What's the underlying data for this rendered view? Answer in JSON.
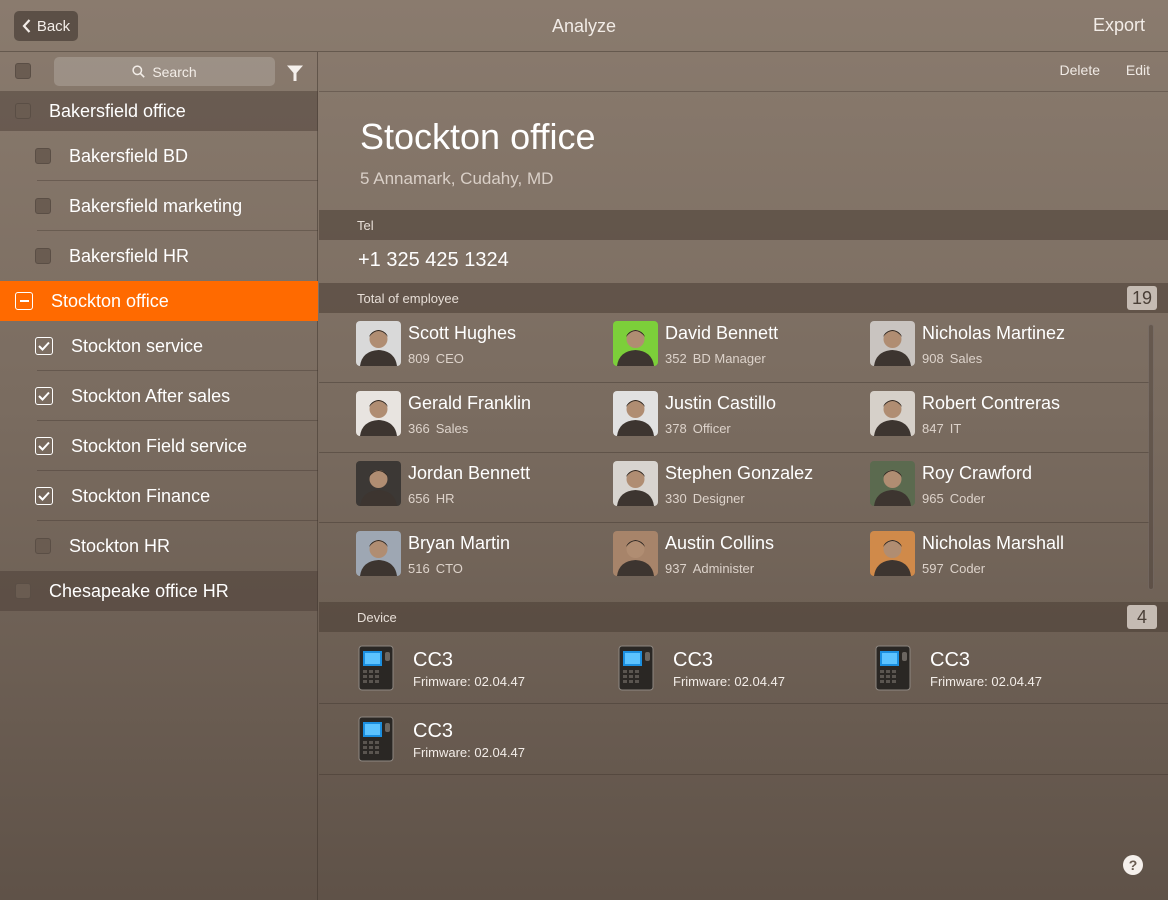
{
  "header": {
    "back_label": "Back",
    "title": "Analyze",
    "export_label": "Export"
  },
  "sidebar": {
    "search_placeholder": "Search",
    "groups": [
      {
        "label": "Bakersfield office",
        "state": "unchecked",
        "children": [
          {
            "label": "Bakersfield BD",
            "state": "unchecked"
          },
          {
            "label": "Bakersfield marketing",
            "state": "unchecked"
          },
          {
            "label": "Bakersfield HR",
            "state": "unchecked"
          }
        ]
      },
      {
        "label": "Stockton office",
        "state": "partial",
        "active": true,
        "children": [
          {
            "label": "Stockton  service",
            "state": "checked"
          },
          {
            "label": "Stockton After sales",
            "state": "checked"
          },
          {
            "label": "Stockton Field service",
            "state": "checked"
          },
          {
            "label": "Stockton Finance",
            "state": "checked"
          },
          {
            "label": "Stockton HR",
            "state": "unchecked"
          }
        ]
      },
      {
        "label": "Chesapeake office HR",
        "state": "unchecked",
        "children": []
      }
    ]
  },
  "main": {
    "delete_label": "Delete",
    "edit_label": "Edit",
    "office_name": "Stockton office",
    "address": "5 Annamark, Cudahy, MD",
    "tel_label": "Tel",
    "tel_value": "+1 325 425 1324",
    "employees_label": "Total of employee",
    "employees_count": "19",
    "employees": [
      {
        "name": "Scott Hughes",
        "id": "809",
        "role": "CEO",
        "avatar_bg": "#d9d9d9"
      },
      {
        "name": "David Bennett",
        "id": "352",
        "role": "BD Manager",
        "avatar_bg": "#7ccf3a"
      },
      {
        "name": "Nicholas Martinez",
        "id": "908",
        "role": "Sales",
        "avatar_bg": "#c9c4c0"
      },
      {
        "name": "Gerald Franklin",
        "id": "366",
        "role": "Sales",
        "avatar_bg": "#e8e4e0"
      },
      {
        "name": "Justin Castillo",
        "id": "378",
        "role": "Officer",
        "avatar_bg": "#e1e1e1"
      },
      {
        "name": "Robert Contreras",
        "id": "847",
        "role": "IT",
        "avatar_bg": "#d6d0c9"
      },
      {
        "name": "Jordan Bennett",
        "id": "656",
        "role": "HR",
        "avatar_bg": "#3c3835"
      },
      {
        "name": "Stephen Gonzalez",
        "id": "330",
        "role": "Designer",
        "avatar_bg": "#d8d4cf"
      },
      {
        "name": "Roy Crawford",
        "id": "965",
        "role": "Coder",
        "avatar_bg": "#5b6a4f"
      },
      {
        "name": "Bryan Martin",
        "id": "516",
        "role": "CTO",
        "avatar_bg": "#9ea7b3"
      },
      {
        "name": "Austin Collins",
        "id": "937",
        "role": "Administer",
        "avatar_bg": "#a7846a"
      },
      {
        "name": "Nicholas Marshall",
        "id": "597",
        "role": "Coder",
        "avatar_bg": "#d08a4a"
      }
    ],
    "device_label": "Device",
    "device_count": "4",
    "devices": [
      {
        "name": "CC3",
        "firmware": "Frimware: 02.04.47"
      },
      {
        "name": "CC3",
        "firmware": "Frimware: 02.04.47"
      },
      {
        "name": "CC3",
        "firmware": "Frimware: 02.04.47"
      },
      {
        "name": "CC3",
        "firmware": "Frimware: 02.04.47"
      }
    ]
  },
  "help_label": "?",
  "colors": {
    "accent": "#ff6a00",
    "badge_bg": "#c5bbb3"
  }
}
